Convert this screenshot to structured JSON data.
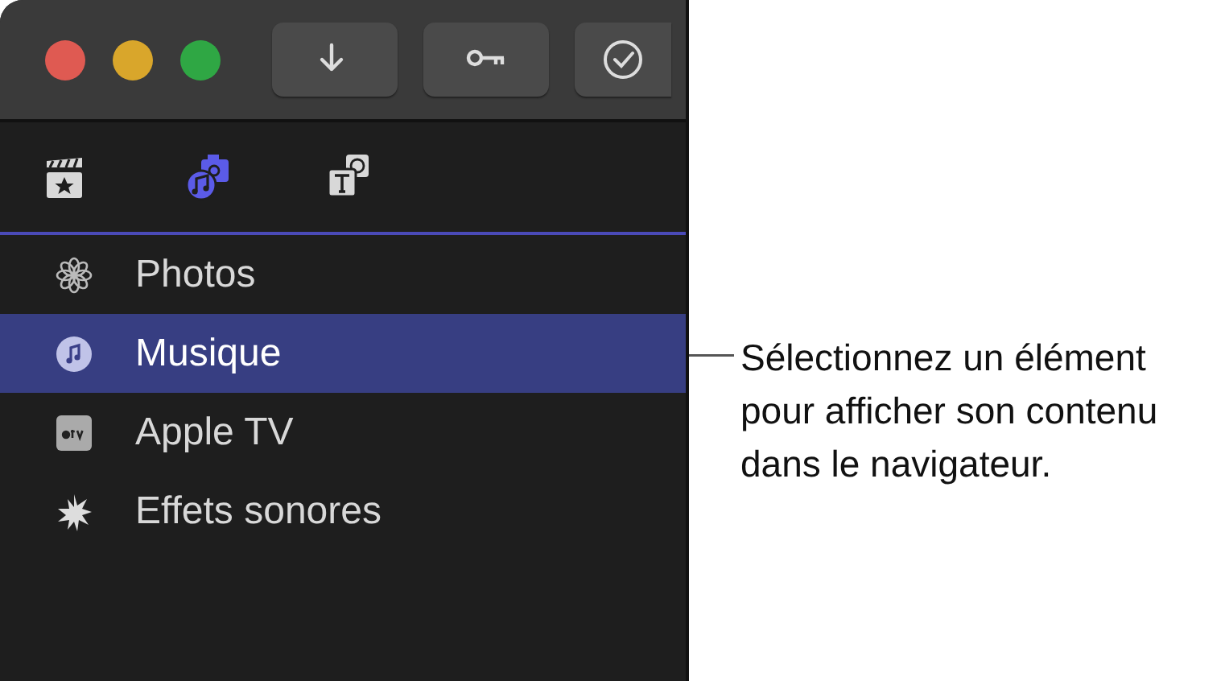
{
  "toolbar": {
    "buttons": [
      {
        "kind": "download"
      },
      {
        "kind": "key"
      },
      {
        "kind": "check"
      }
    ]
  },
  "tabs": [
    {
      "selected": false
    },
    {
      "selected": true
    },
    {
      "selected": false
    }
  ],
  "sidebar": {
    "items": [
      {
        "label": "Photos",
        "selected": false
      },
      {
        "label": "Musique",
        "selected": true
      },
      {
        "label": "Apple TV",
        "selected": false
      },
      {
        "label": "Effets sonores",
        "selected": false
      }
    ]
  },
  "callout": {
    "text": "Sélectionnez un élément pour afficher son contenu dans le navigateur."
  }
}
